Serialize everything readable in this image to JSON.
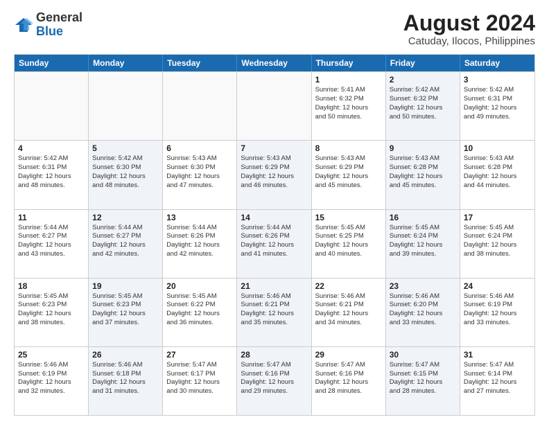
{
  "logo": {
    "general": "General",
    "blue": "Blue"
  },
  "title": "August 2024",
  "subtitle": "Catuday, Ilocos, Philippines",
  "days": [
    "Sunday",
    "Monday",
    "Tuesday",
    "Wednesday",
    "Thursday",
    "Friday",
    "Saturday"
  ],
  "weeks": [
    [
      {
        "day": "",
        "empty": true
      },
      {
        "day": "",
        "empty": true
      },
      {
        "day": "",
        "empty": true
      },
      {
        "day": "",
        "empty": true
      },
      {
        "day": "1",
        "sunrise": "5:41 AM",
        "sunset": "6:32 PM",
        "daylight": "12 hours and 50 minutes."
      },
      {
        "day": "2",
        "sunrise": "5:42 AM",
        "sunset": "6:32 PM",
        "daylight": "12 hours and 50 minutes."
      },
      {
        "day": "3",
        "sunrise": "5:42 AM",
        "sunset": "6:31 PM",
        "daylight": "12 hours and 49 minutes."
      }
    ],
    [
      {
        "day": "4",
        "sunrise": "5:42 AM",
        "sunset": "6:31 PM",
        "daylight": "12 hours and 48 minutes."
      },
      {
        "day": "5",
        "sunrise": "5:42 AM",
        "sunset": "6:30 PM",
        "daylight": "12 hours and 48 minutes."
      },
      {
        "day": "6",
        "sunrise": "5:43 AM",
        "sunset": "6:30 PM",
        "daylight": "12 hours and 47 minutes."
      },
      {
        "day": "7",
        "sunrise": "5:43 AM",
        "sunset": "6:29 PM",
        "daylight": "12 hours and 46 minutes."
      },
      {
        "day": "8",
        "sunrise": "5:43 AM",
        "sunset": "6:29 PM",
        "daylight": "12 hours and 45 minutes."
      },
      {
        "day": "9",
        "sunrise": "5:43 AM",
        "sunset": "6:28 PM",
        "daylight": "12 hours and 45 minutes."
      },
      {
        "day": "10",
        "sunrise": "5:43 AM",
        "sunset": "6:28 PM",
        "daylight": "12 hours and 44 minutes."
      }
    ],
    [
      {
        "day": "11",
        "sunrise": "5:44 AM",
        "sunset": "6:27 PM",
        "daylight": "12 hours and 43 minutes."
      },
      {
        "day": "12",
        "sunrise": "5:44 AM",
        "sunset": "6:27 PM",
        "daylight": "12 hours and 42 minutes."
      },
      {
        "day": "13",
        "sunrise": "5:44 AM",
        "sunset": "6:26 PM",
        "daylight": "12 hours and 42 minutes."
      },
      {
        "day": "14",
        "sunrise": "5:44 AM",
        "sunset": "6:26 PM",
        "daylight": "12 hours and 41 minutes."
      },
      {
        "day": "15",
        "sunrise": "5:45 AM",
        "sunset": "6:25 PM",
        "daylight": "12 hours and 40 minutes."
      },
      {
        "day": "16",
        "sunrise": "5:45 AM",
        "sunset": "6:24 PM",
        "daylight": "12 hours and 39 minutes."
      },
      {
        "day": "17",
        "sunrise": "5:45 AM",
        "sunset": "6:24 PM",
        "daylight": "12 hours and 38 minutes."
      }
    ],
    [
      {
        "day": "18",
        "sunrise": "5:45 AM",
        "sunset": "6:23 PM",
        "daylight": "12 hours and 38 minutes."
      },
      {
        "day": "19",
        "sunrise": "5:45 AM",
        "sunset": "6:23 PM",
        "daylight": "12 hours and 37 minutes."
      },
      {
        "day": "20",
        "sunrise": "5:45 AM",
        "sunset": "6:22 PM",
        "daylight": "12 hours and 36 minutes."
      },
      {
        "day": "21",
        "sunrise": "5:46 AM",
        "sunset": "6:21 PM",
        "daylight": "12 hours and 35 minutes."
      },
      {
        "day": "22",
        "sunrise": "5:46 AM",
        "sunset": "6:21 PM",
        "daylight": "12 hours and 34 minutes."
      },
      {
        "day": "23",
        "sunrise": "5:46 AM",
        "sunset": "6:20 PM",
        "daylight": "12 hours and 33 minutes."
      },
      {
        "day": "24",
        "sunrise": "5:46 AM",
        "sunset": "6:19 PM",
        "daylight": "12 hours and 33 minutes."
      }
    ],
    [
      {
        "day": "25",
        "sunrise": "5:46 AM",
        "sunset": "6:19 PM",
        "daylight": "12 hours and 32 minutes."
      },
      {
        "day": "26",
        "sunrise": "5:46 AM",
        "sunset": "6:18 PM",
        "daylight": "12 hours and 31 minutes."
      },
      {
        "day": "27",
        "sunrise": "5:47 AM",
        "sunset": "6:17 PM",
        "daylight": "12 hours and 30 minutes."
      },
      {
        "day": "28",
        "sunrise": "5:47 AM",
        "sunset": "6:16 PM",
        "daylight": "12 hours and 29 minutes."
      },
      {
        "day": "29",
        "sunrise": "5:47 AM",
        "sunset": "6:16 PM",
        "daylight": "12 hours and 28 minutes."
      },
      {
        "day": "30",
        "sunrise": "5:47 AM",
        "sunset": "6:15 PM",
        "daylight": "12 hours and 28 minutes."
      },
      {
        "day": "31",
        "sunrise": "5:47 AM",
        "sunset": "6:14 PM",
        "daylight": "12 hours and 27 minutes."
      }
    ]
  ],
  "labels": {
    "sunrise": "Sunrise:",
    "sunset": "Sunset:",
    "daylight": "Daylight:"
  }
}
